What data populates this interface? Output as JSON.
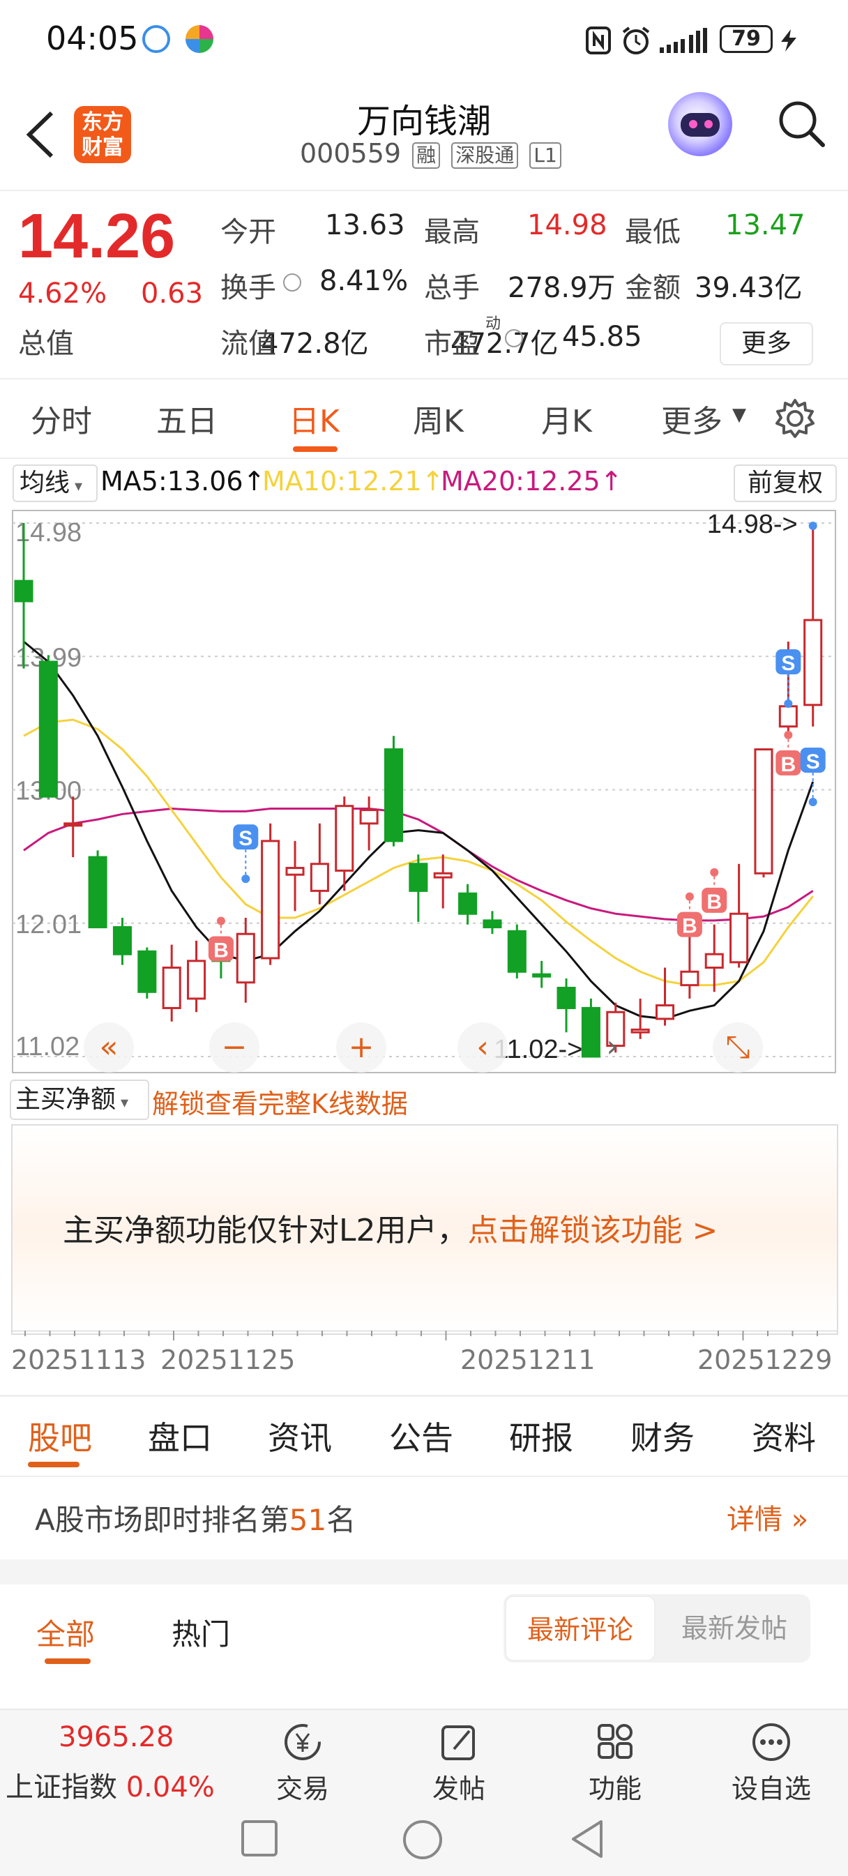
{
  "status_bar": {
    "time": "04:05",
    "battery": "79"
  },
  "header": {
    "logo_text": [
      "东方",
      "财富"
    ],
    "stock_name": "万向钱潮",
    "stock_code": "000559",
    "tags": [
      "融",
      "深股通",
      "L1"
    ]
  },
  "quote": {
    "price": "14.26",
    "change_pct": "4.62%",
    "change_amt": "0.63",
    "rows": [
      [
        {
          "label": "今开",
          "value": "13.63",
          "color": "default"
        },
        {
          "label": "最高",
          "value": "14.98",
          "color": "red"
        },
        {
          "label": "最低",
          "value": "13.47",
          "color": "green"
        }
      ],
      [
        {
          "label": "换手",
          "value": "8.41%",
          "color": "default"
        },
        {
          "label": "总手",
          "value": "278.9万",
          "color": "default"
        },
        {
          "label": "金额",
          "value": "39.43亿",
          "color": "default"
        }
      ],
      [
        {
          "label": "总值",
          "value": "472.8亿",
          "color": "default"
        },
        {
          "label": "流值",
          "value": "472.7亿",
          "color": "default"
        },
        {
          "label": "市盈",
          "sup": "动",
          "value": "45.85",
          "color": "default"
        }
      ]
    ],
    "more_label": "更多"
  },
  "period_tabs": [
    "分时",
    "五日",
    "日K",
    "周K",
    "月K",
    "更多"
  ],
  "period_active": "日K",
  "ma_bar": {
    "selector": "均线",
    "ma5": "MA5:13.06↑",
    "ma10": "MA10:12.21↑",
    "ma20": "MA20:12.25↑",
    "adjust": "前复权"
  },
  "colors": {
    "up": "#c8282d",
    "down": "#12a025",
    "ma5": "#111111",
    "ma10": "#f5d23c",
    "ma20": "#c8197d",
    "accent": "#e0601a"
  },
  "chart_data": {
    "type": "candlestick",
    "y_axis_labels": [
      "14.98",
      "13.99",
      "13.00",
      "12.01",
      "11.02"
    ],
    "ylim": [
      11.02,
      14.98
    ],
    "max_marker": "14.98->",
    "min_marker": "11.02->",
    "candles": [
      {
        "o": 14.4,
        "c": 14.55,
        "h": 14.98,
        "l": 13.9,
        "dir": "down"
      },
      {
        "o": 13.95,
        "c": 12.95,
        "h": 14.0,
        "l": 12.95,
        "dir": "down"
      },
      {
        "o": 12.75,
        "c": 12.75,
        "h": 12.95,
        "l": 12.5,
        "dir": "up"
      },
      {
        "o": 12.5,
        "c": 11.98,
        "h": 12.55,
        "l": 11.98,
        "dir": "down"
      },
      {
        "o": 11.98,
        "c": 11.78,
        "h": 12.05,
        "l": 11.7,
        "dir": "down"
      },
      {
        "o": 11.8,
        "c": 11.5,
        "h": 11.83,
        "l": 11.45,
        "dir": "down"
      },
      {
        "o": 11.38,
        "c": 11.68,
        "h": 11.85,
        "l": 11.28,
        "dir": "up"
      },
      {
        "o": 11.45,
        "c": 11.73,
        "h": 11.88,
        "l": 11.35,
        "dir": "up"
      },
      {
        "o": 11.82,
        "c": 11.73,
        "h": 11.9,
        "l": 11.6,
        "dir": "down"
      },
      {
        "o": 11.57,
        "c": 11.93,
        "h": 12.05,
        "l": 11.42,
        "dir": "up"
      },
      {
        "o": 11.75,
        "c": 12.62,
        "h": 12.75,
        "l": 11.7,
        "dir": "up"
      },
      {
        "o": 12.37,
        "c": 12.42,
        "h": 12.62,
        "l": 12.1,
        "dir": "up"
      },
      {
        "o": 12.25,
        "c": 12.45,
        "h": 12.75,
        "l": 12.15,
        "dir": "up"
      },
      {
        "o": 12.4,
        "c": 12.88,
        "h": 12.95,
        "l": 12.25,
        "dir": "up"
      },
      {
        "o": 12.75,
        "c": 12.85,
        "h": 12.95,
        "l": 12.55,
        "dir": "up"
      },
      {
        "o": 13.3,
        "c": 12.62,
        "h": 13.4,
        "l": 12.58,
        "dir": "down"
      },
      {
        "o": 12.45,
        "c": 12.25,
        "h": 12.52,
        "l": 12.02,
        "dir": "down"
      },
      {
        "o": 12.35,
        "c": 12.38,
        "h": 12.52,
        "l": 12.12,
        "dir": "up"
      },
      {
        "o": 12.23,
        "c": 12.08,
        "h": 12.3,
        "l": 12.0,
        "dir": "down"
      },
      {
        "o": 12.03,
        "c": 11.98,
        "h": 12.1,
        "l": 11.93,
        "dir": "down"
      },
      {
        "o": 11.95,
        "c": 11.65,
        "h": 12.0,
        "l": 11.6,
        "dir": "down"
      },
      {
        "o": 11.63,
        "c": 11.63,
        "h": 11.73,
        "l": 11.53,
        "dir": "down"
      },
      {
        "o": 11.53,
        "c": 11.38,
        "h": 11.6,
        "l": 11.2,
        "dir": "down"
      },
      {
        "o": 11.38,
        "c": 11.02,
        "h": 11.45,
        "l": 11.02,
        "dir": "down"
      },
      {
        "o": 11.1,
        "c": 11.35,
        "h": 11.42,
        "l": 11.05,
        "dir": "up"
      },
      {
        "o": 11.2,
        "c": 11.22,
        "h": 11.45,
        "l": 11.15,
        "dir": "up"
      },
      {
        "o": 11.3,
        "c": 11.4,
        "h": 11.68,
        "l": 11.25,
        "dir": "up"
      },
      {
        "o": 11.55,
        "c": 11.65,
        "h": 11.95,
        "l": 11.45,
        "dir": "up"
      },
      {
        "o": 11.68,
        "c": 11.78,
        "h": 12.0,
        "l": 11.5,
        "dir": "up"
      },
      {
        "o": 11.72,
        "c": 12.08,
        "h": 12.45,
        "l": 11.68,
        "dir": "up"
      },
      {
        "o": 12.38,
        "c": 13.3,
        "h": 13.3,
        "l": 12.35,
        "dir": "up"
      },
      {
        "o": 13.47,
        "c": 13.62,
        "h": 14.1,
        "l": 13.4,
        "dir": "up"
      },
      {
        "o": 13.63,
        "c": 14.26,
        "h": 14.98,
        "l": 13.47,
        "dir": "up"
      }
    ],
    "ma5": [
      14.1,
      13.95,
      13.7,
      13.4,
      13.02,
      12.62,
      12.25,
      11.98,
      11.78,
      11.73,
      11.78,
      11.95,
      12.1,
      12.3,
      12.5,
      12.68,
      12.7,
      12.68,
      12.55,
      12.4,
      12.2,
      12.0,
      11.8,
      11.58,
      11.4,
      11.32,
      11.3,
      11.36,
      11.4,
      11.58,
      11.95,
      12.55,
      13.06
    ],
    "ma10": [
      13.4,
      13.5,
      13.52,
      13.45,
      13.3,
      13.1,
      12.85,
      12.6,
      12.35,
      12.15,
      12.05,
      12.05,
      12.12,
      12.22,
      12.32,
      12.42,
      12.48,
      12.5,
      12.47,
      12.4,
      12.3,
      12.18,
      12.02,
      11.88,
      11.75,
      11.65,
      11.58,
      11.55,
      11.55,
      11.58,
      11.72,
      11.98,
      12.21
    ],
    "ma20": [
      12.55,
      12.68,
      12.75,
      12.78,
      12.82,
      12.84,
      12.86,
      12.85,
      12.84,
      12.84,
      12.86,
      12.86,
      12.86,
      12.86,
      12.86,
      12.84,
      12.78,
      12.68,
      12.55,
      12.43,
      12.33,
      12.25,
      12.18,
      12.12,
      12.08,
      12.06,
      12.04,
      12.03,
      12.03,
      12.04,
      12.06,
      12.13,
      12.25
    ],
    "signals": [
      {
        "i": 9,
        "type": "S",
        "price": 12.65
      },
      {
        "i": 8,
        "type": "B",
        "price": 11.82
      },
      {
        "i": 27,
        "type": "B",
        "price": 12.0
      },
      {
        "i": 28,
        "type": "B",
        "price": 12.18
      },
      {
        "i": 31,
        "type": "S",
        "price": 13.95
      },
      {
        "i": 31,
        "type": "B",
        "price": 13.2
      },
      {
        "i": 32,
        "type": "S",
        "price": 13.22
      }
    ],
    "controls": [
      "«",
      "−",
      "+",
      "‹",
      "›",
      "⤡"
    ]
  },
  "fund_flow": {
    "selector": "主买净额",
    "unlock_link": "解锁查看完整K线数据",
    "message": "主买净额功能仅针对L2用户，",
    "message_link": "点击解锁该功能 >"
  },
  "dates": [
    "20251113",
    "20251125",
    "20251211",
    "20251229"
  ],
  "section_tabs": [
    "股吧",
    "盘口",
    "资讯",
    "公告",
    "研报",
    "财务",
    "资料"
  ],
  "section_active": "股吧",
  "ranking": {
    "prefix": "A股市场即时排名第",
    "number": "51",
    "suffix": "名",
    "detail": "详情"
  },
  "forum": {
    "tabs": [
      "全部",
      "热门"
    ],
    "active": "全部",
    "sort": [
      "最新评论",
      "最新发帖"
    ],
    "sort_active": "最新评论"
  },
  "bottom_bar": {
    "index_value": "3965.28",
    "index_name": "上证指数",
    "index_change": "0.04%",
    "nav": [
      "交易",
      "发帖",
      "功能",
      "设自选"
    ]
  }
}
